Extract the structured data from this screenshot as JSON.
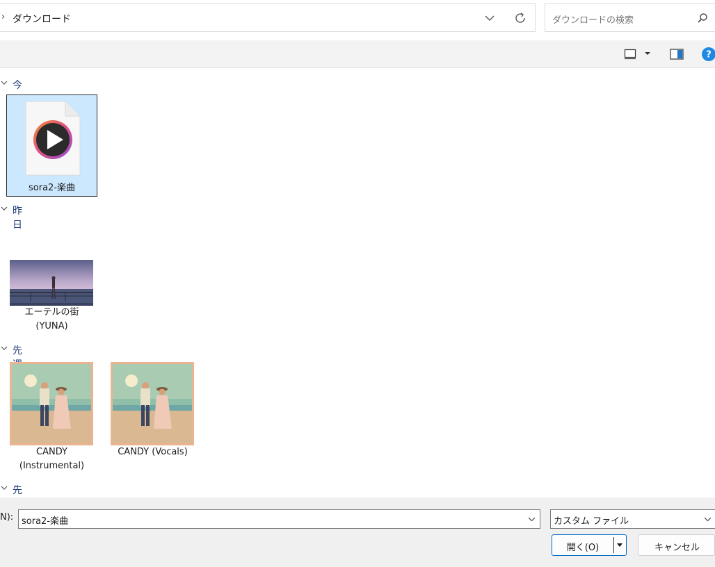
{
  "address": {
    "path": "ダウンロード"
  },
  "search": {
    "placeholder": "ダウンロードの検索"
  },
  "groups": [
    {
      "label": "今日"
    },
    {
      "label": "昨日"
    },
    {
      "label": "先週"
    },
    {
      "label": "先月"
    }
  ],
  "files": [
    {
      "name": "sora2-楽曲",
      "icon": "media-file-icon",
      "selected": true
    },
    {
      "name": "エーテルの街\n(YUNA)",
      "icon": "thumbnail-seaside"
    },
    {
      "name": "CANDY\n(Instrumental)",
      "icon": "thumbnail-couple"
    },
    {
      "name": "CANDY (Vocals)",
      "icon": "thumbnail-couple"
    }
  ],
  "bottom": {
    "filename_label": "N):",
    "filename_value": "sora2-楽曲",
    "filetype_value": "カスタム ファイル",
    "open_label": "開く(O)",
    "cancel_label": "キャンセル"
  },
  "colors": {
    "accent": "#0067c0",
    "selection": "#cce8ff",
    "group_header": "#1e3a78"
  }
}
